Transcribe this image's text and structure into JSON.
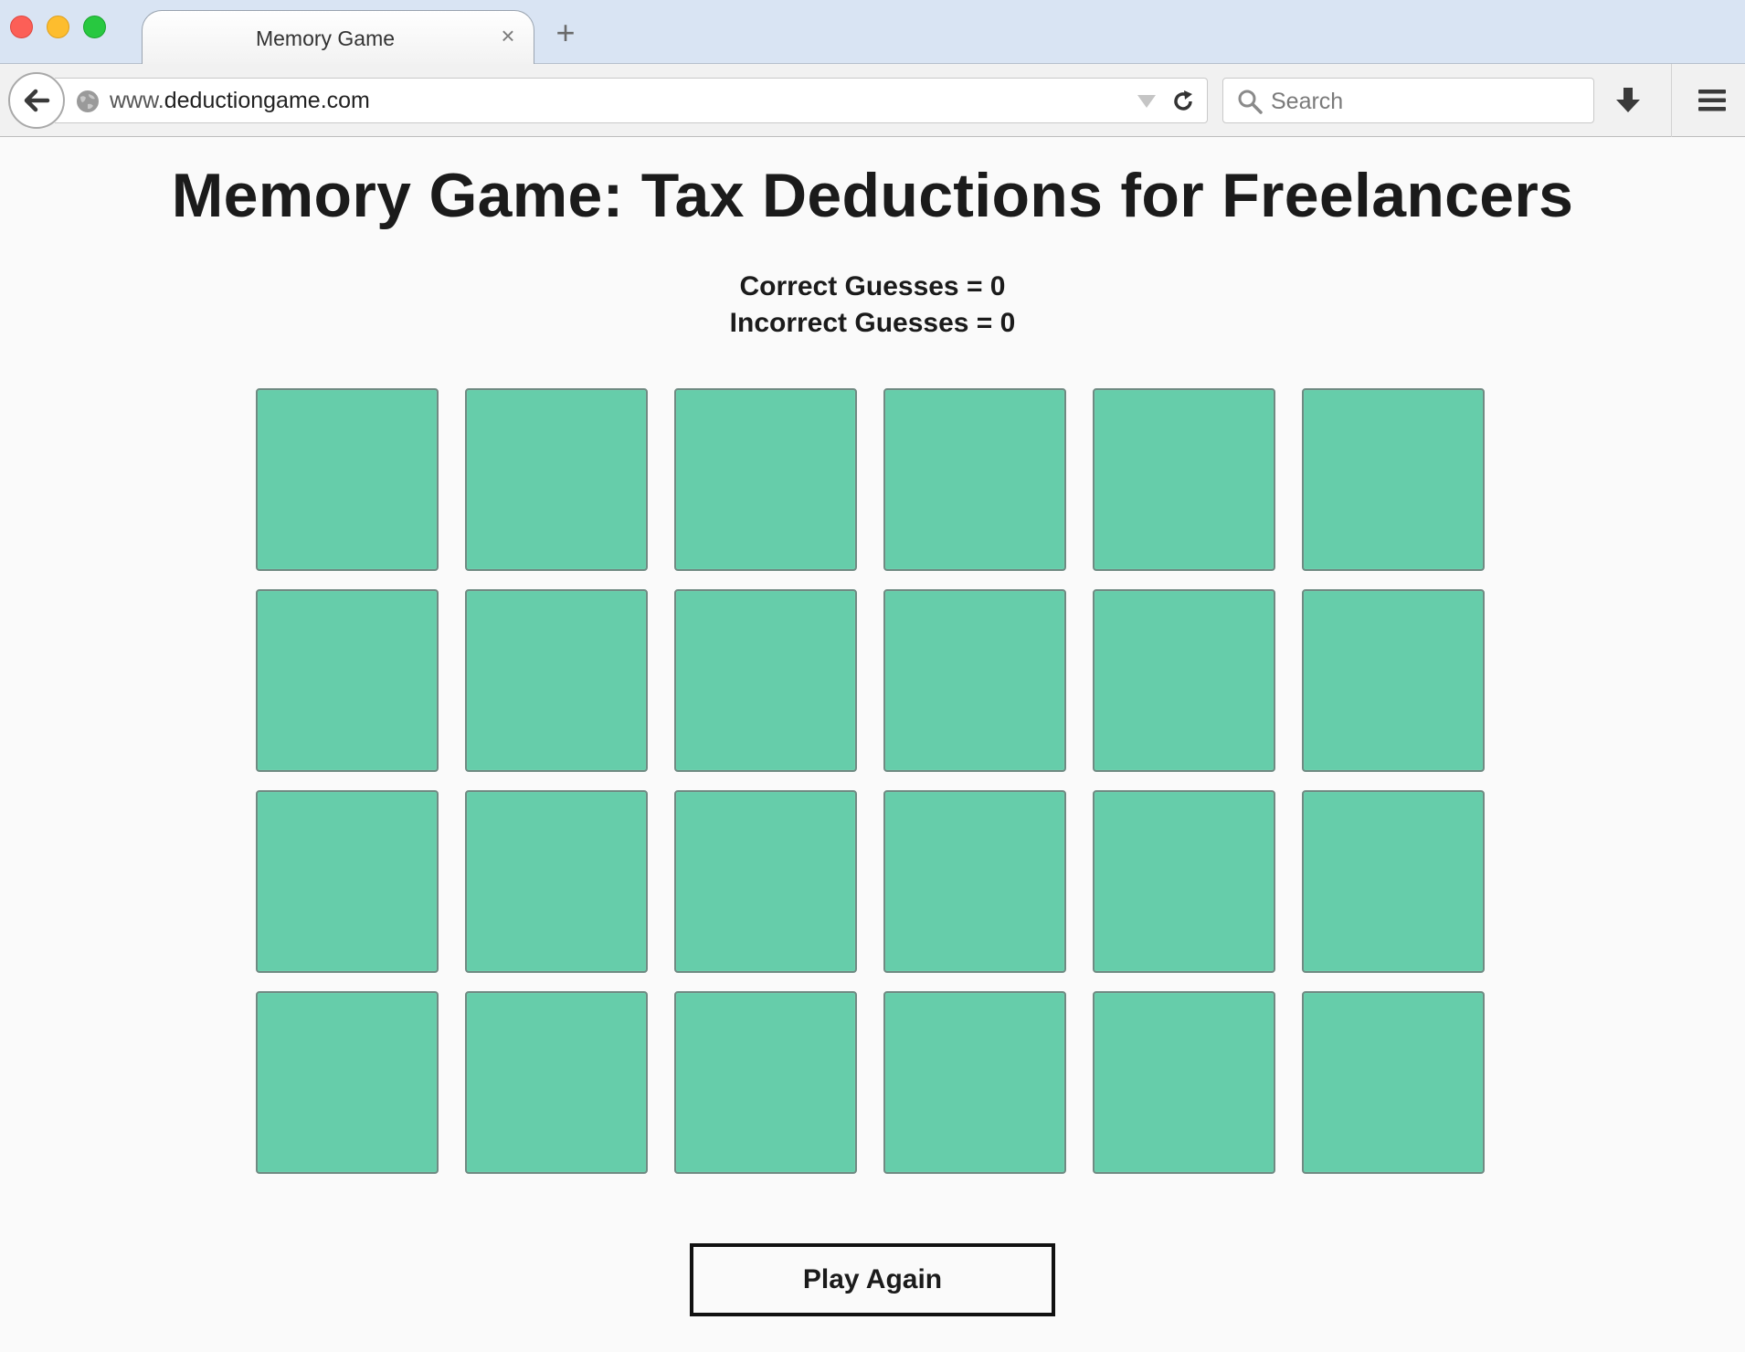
{
  "browser": {
    "tab_title": "Memory Game",
    "tab_close": "×",
    "new_tab": "+",
    "url_prefix": "www.",
    "url_domain": "deductiongame.com",
    "search_placeholder": "Search"
  },
  "game": {
    "title": "Memory Game: Tax Deductions for Freelancers",
    "correct_guesses": "Correct Guesses = 0",
    "incorrect_guesses": "Incorrect Guesses = 0",
    "rows": 4,
    "columns": 6,
    "card_color": "#66cdaa",
    "play_again_label": "Play Again"
  }
}
